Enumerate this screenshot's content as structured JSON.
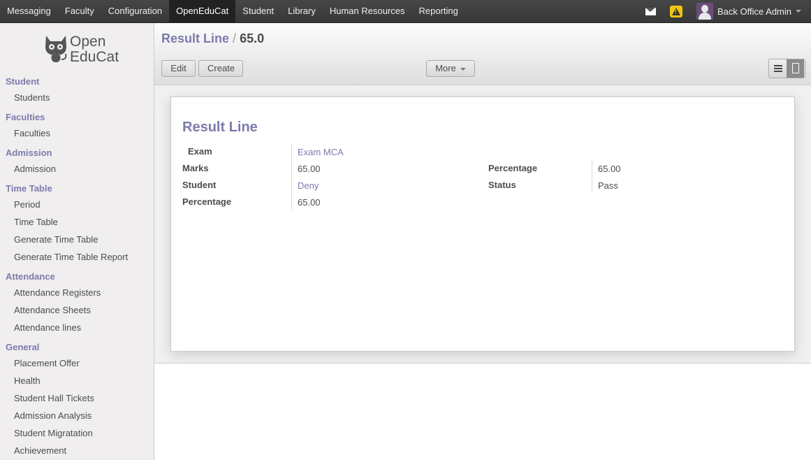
{
  "topbar": {
    "menu": [
      "Messaging",
      "Faculty",
      "Configuration",
      "OpenEduCat",
      "Student",
      "Library",
      "Human Resources",
      "Reporting"
    ],
    "active_index": 3,
    "user": "Back Office Admin"
  },
  "logo": {
    "line1": "Open",
    "line2": "EduCat"
  },
  "sidebar": {
    "sections": [
      {
        "title": "Student",
        "items": [
          "Students"
        ]
      },
      {
        "title": "Faculties",
        "items": [
          "Faculties"
        ]
      },
      {
        "title": "Admission",
        "items": [
          "Admission"
        ]
      },
      {
        "title": "Time Table",
        "items": [
          "Period",
          "Time Table",
          "Generate Time Table",
          "Generate Time Table Report"
        ]
      },
      {
        "title": "Attendance",
        "items": [
          "Attendance Registers",
          "Attendance Sheets",
          "Attendance lines"
        ]
      },
      {
        "title": "General",
        "items": [
          "Placement Offer",
          "Health",
          "Student Hall Tickets",
          "Admission Analysis",
          "Student Migratation",
          "Achievement"
        ]
      }
    ]
  },
  "header": {
    "breadcrumb_link": "Result Line",
    "breadcrumb_sep": "/",
    "breadcrumb_current": "65.0",
    "edit_label": "Edit",
    "create_label": "Create",
    "more_label": "More"
  },
  "form": {
    "title": "Result Line",
    "exam_label": "Exam",
    "exam_value": "Exam MCA",
    "marks_label": "Marks",
    "marks_value": "65.00",
    "student_label": "Student",
    "student_value": "Deny",
    "percentage_label_left": "Percentage",
    "percentage_value_left": "65.00",
    "percentage_label_right": "Percentage",
    "percentage_value_right": "65.00",
    "status_label": "Status",
    "status_value": "Pass"
  },
  "colors": {
    "accent": "#7c7bad",
    "topbar": "#3f3f3f"
  }
}
